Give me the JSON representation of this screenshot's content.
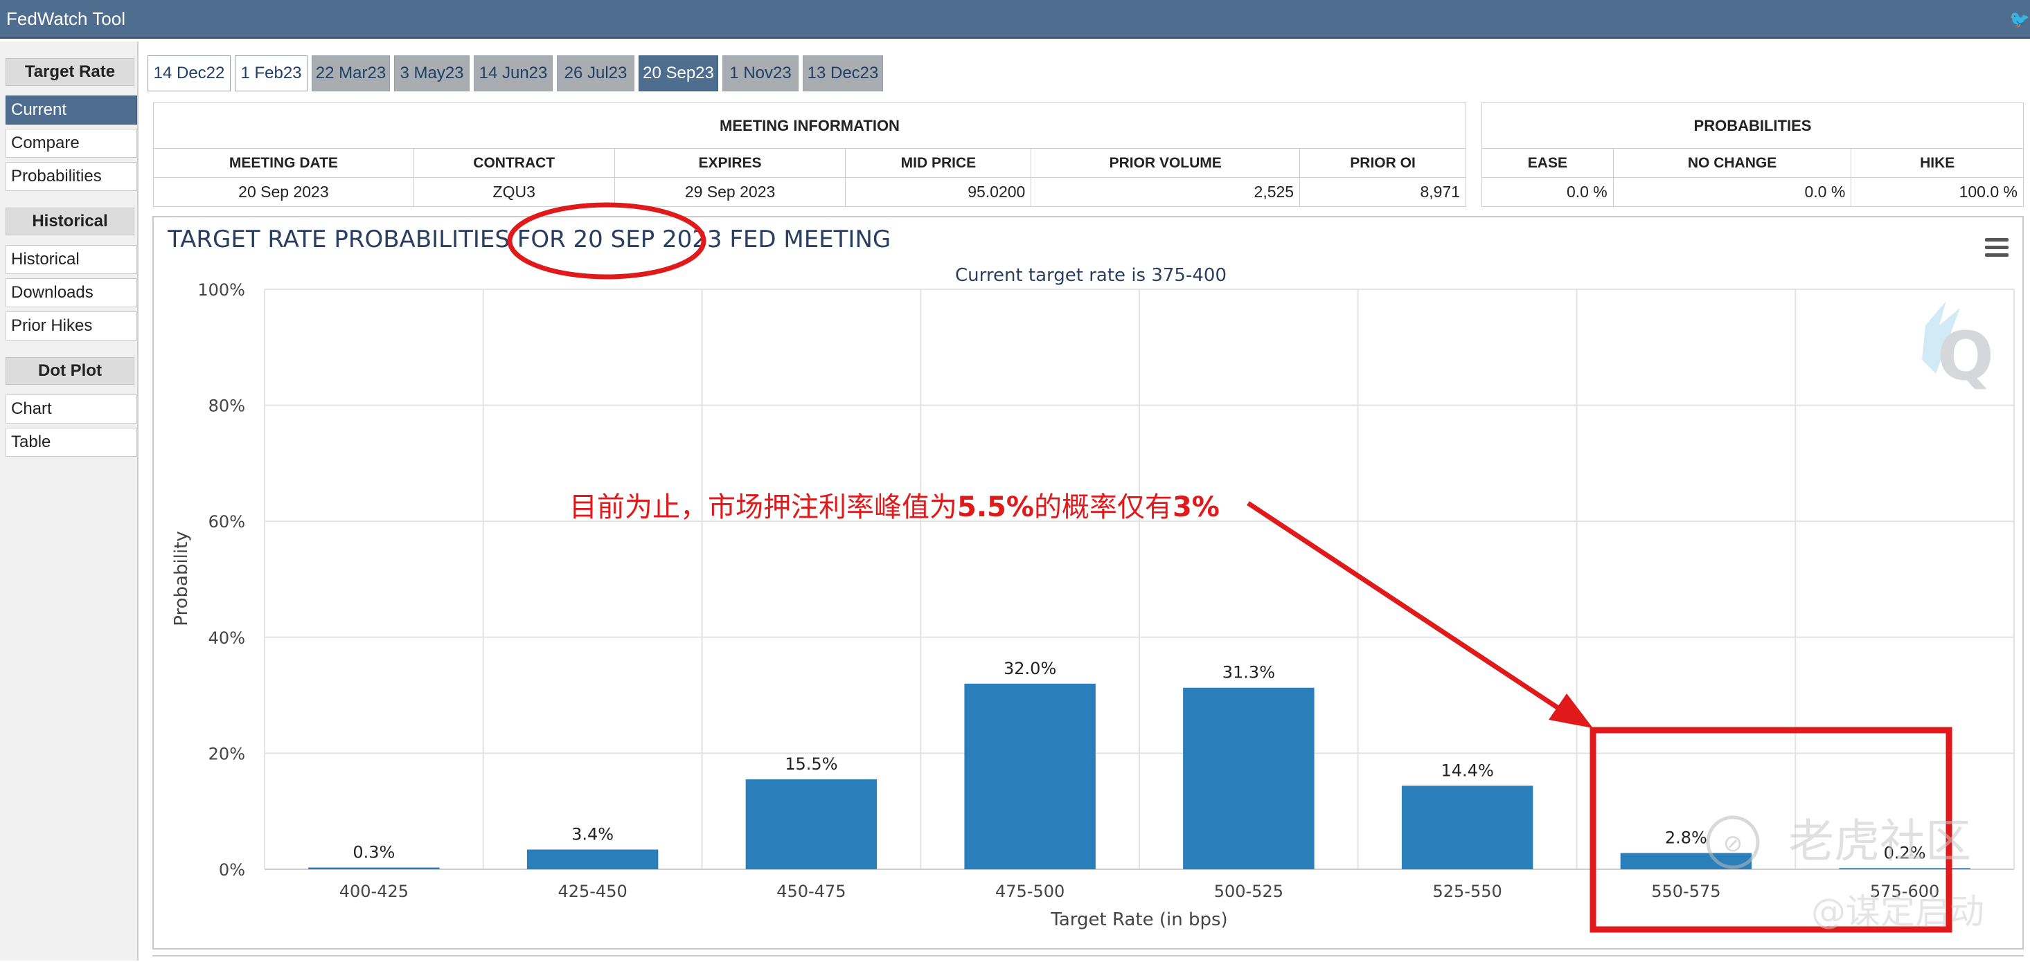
{
  "app": {
    "title": "FedWatch Tool"
  },
  "sidebar": {
    "sections": [
      {
        "heading": "Target Rate",
        "items": [
          "Current",
          "Compare",
          "Probabilities"
        ]
      },
      {
        "heading": "Historical",
        "items": [
          "Historical",
          "Downloads",
          "Prior Hikes"
        ]
      },
      {
        "heading": "Dot Plot",
        "items": [
          "Chart",
          "Table"
        ]
      }
    ],
    "active_item": "Current"
  },
  "tabs": [
    "14 Dec22",
    "1 Feb23",
    "22 Mar23",
    "3 May23",
    "14 Jun23",
    "26 Jul23",
    "20 Sep23",
    "1 Nov23",
    "13 Dec23"
  ],
  "active_tab": "20 Sep23",
  "meeting_info": {
    "caption": "MEETING INFORMATION",
    "headers": [
      "MEETING DATE",
      "CONTRACT",
      "EXPIRES",
      "MID PRICE",
      "PRIOR VOLUME",
      "PRIOR OI"
    ],
    "values": [
      "20 Sep 2023",
      "ZQU3",
      "29 Sep 2023",
      "95.0200",
      "2,525",
      "8,971"
    ]
  },
  "probabilities": {
    "caption": "PROBABILITIES",
    "headers": [
      "EASE",
      "NO CHANGE",
      "HIKE"
    ],
    "values": [
      "0.0 %",
      "0.0 %",
      "100.0 %"
    ]
  },
  "chart": {
    "title": "TARGET RATE PROBABILITIES FOR 20 SEP 2023 FED MEETING",
    "subtitle": "Current target rate is 375-400",
    "menu_icon": "hamburger-menu-icon",
    "logo_icon": "cme-q-logo-icon",
    "bar_color": "#2a7fba"
  },
  "chart_data": {
    "type": "bar",
    "title": "TARGET RATE PROBABILITIES FOR 20 SEP 2023 FED MEETING",
    "subtitle": "Current target rate is 375-400",
    "xlabel": "Target Rate (in bps)",
    "ylabel": "Probability",
    "ylim": [
      0,
      100
    ],
    "yticks": [
      "0%",
      "20%",
      "40%",
      "60%",
      "80%",
      "100%"
    ],
    "categories": [
      "400-425",
      "425-450",
      "450-475",
      "475-500",
      "500-525",
      "525-550",
      "550-575",
      "575-600"
    ],
    "values": [
      0.3,
      3.4,
      15.5,
      32.0,
      31.3,
      14.4,
      2.8,
      0.2
    ],
    "data_labels": [
      "0.3%",
      "3.4%",
      "15.5%",
      "32.0%",
      "31.3%",
      "14.4%",
      "2.8%",
      "0.2%"
    ],
    "grid": true,
    "legend": "none"
  },
  "annotations": {
    "note_prefix": "目前为止，市场押注利率峰值为",
    "note_bold1": "5.5%",
    "note_middle": "的概率仅有",
    "note_bold2": "3%",
    "color": "#e0191b",
    "watermark_line1": "老虎社区",
    "watermark_line2": "@谋定启动"
  }
}
